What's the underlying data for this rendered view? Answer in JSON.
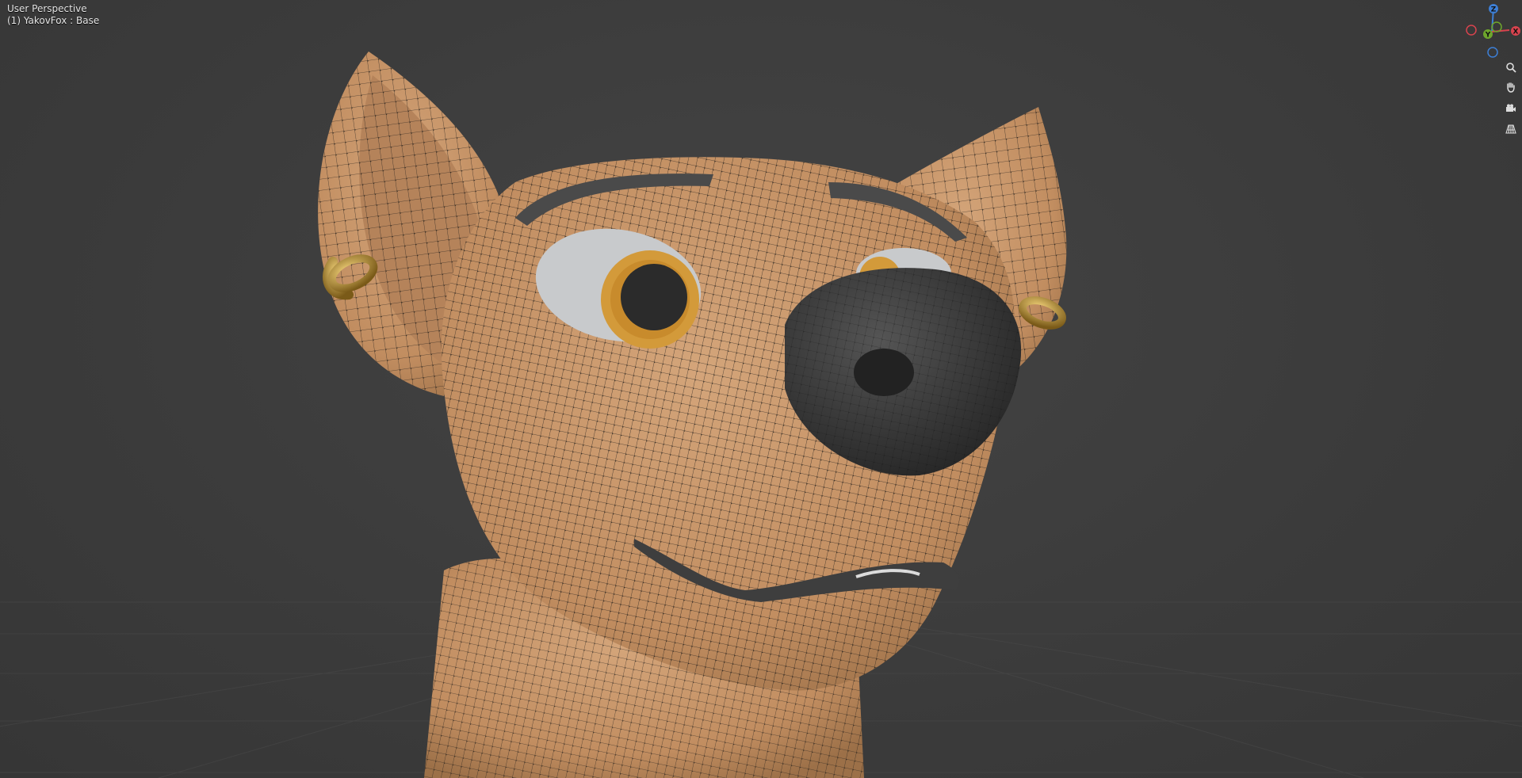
{
  "viewport": {
    "view_name": "User Perspective",
    "object_label": "(1) YakovFox : Base"
  },
  "gizmo": {
    "axis_z": "Z",
    "axis_y": "Y",
    "axis_x": "X",
    "color_x": "#d8434e",
    "color_y": "#6ea62c",
    "color_z": "#3d7fd6"
  },
  "nav_tools": [
    {
      "name": "zoom-view-button",
      "icon": "magnifier-icon"
    },
    {
      "name": "pan-view-button",
      "icon": "hand-icon"
    },
    {
      "name": "camera-view-button",
      "icon": "camera-icon"
    },
    {
      "name": "ortho-toggle-button",
      "icon": "grid-icon"
    }
  ],
  "model": {
    "skin_color": "#c99668",
    "nose_color": "#3a3a3a",
    "eye_white": "#c8cacc",
    "iris_color": "#d39a3a",
    "pupil_color": "#2b2b2b",
    "earring_color": "#c9982e",
    "wire_color": "#151515"
  }
}
